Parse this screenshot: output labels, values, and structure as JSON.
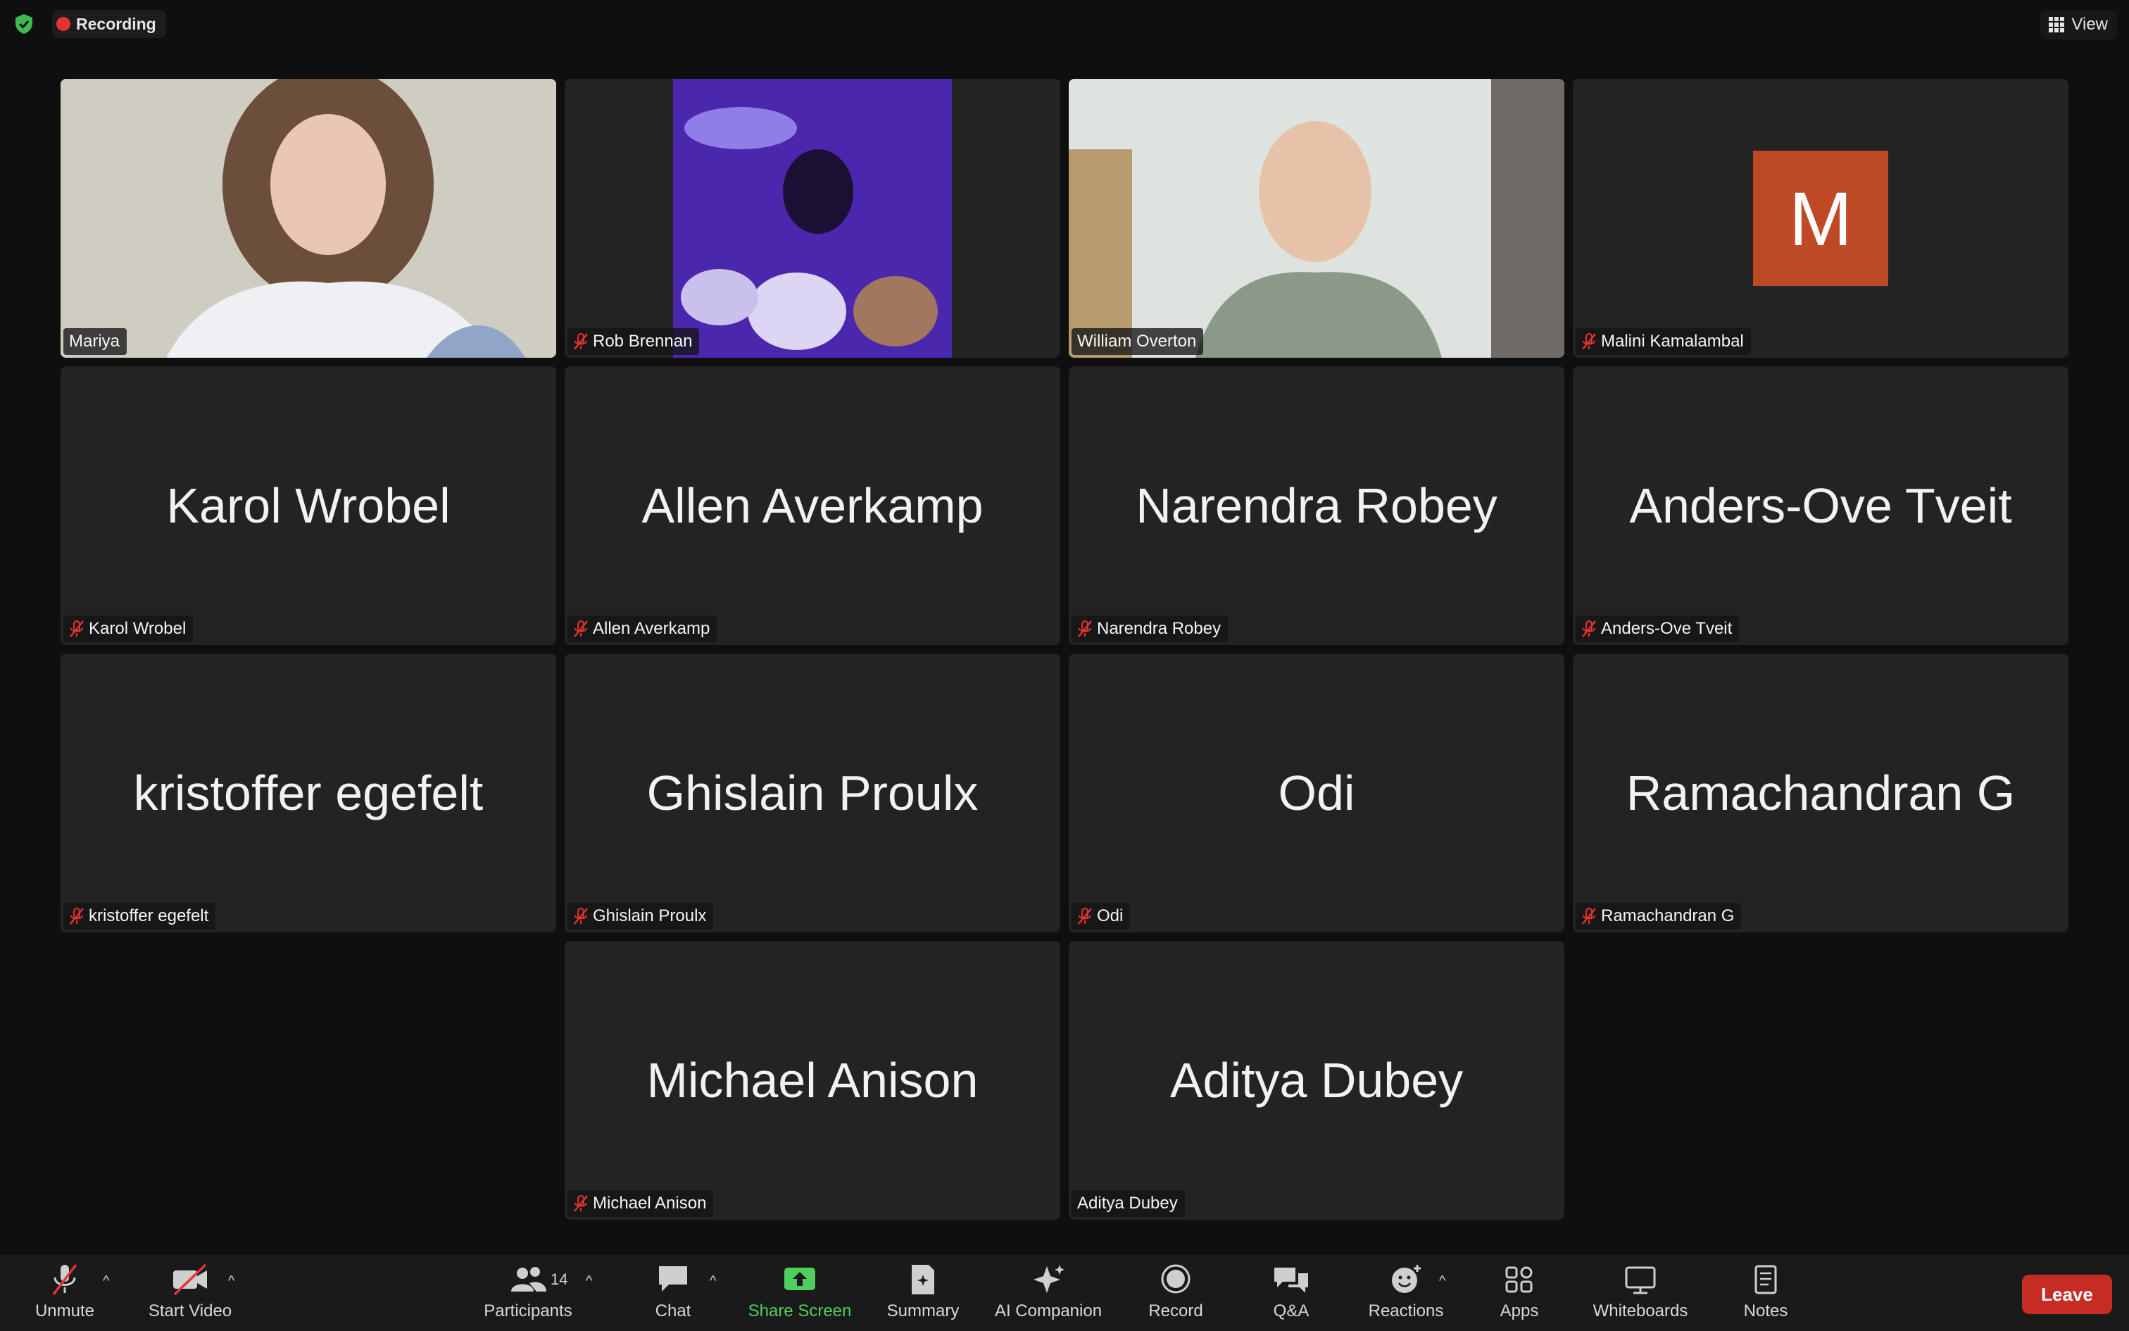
{
  "topbar": {
    "recording_label": "Recording",
    "view_label": "View"
  },
  "tiles": [
    {
      "name": "Mariya",
      "muted": false,
      "video": true,
      "active": true
    },
    {
      "name": "Rob Brennan",
      "muted": true,
      "video": true
    },
    {
      "name": "William Overton",
      "muted": false,
      "video": true
    },
    {
      "name": "Malini Kamalambal",
      "muted": true,
      "avatar": "M"
    },
    {
      "name": "Karol Wrobel",
      "muted": true,
      "display_name": "Karol Wrobel"
    },
    {
      "name": "Allen Averkamp",
      "muted": true,
      "display_name": "Allen Averkamp"
    },
    {
      "name": "Narendra Robey",
      "muted": true,
      "display_name": "Narendra Robey"
    },
    {
      "name": "Anders-Ove Tveit",
      "muted": true,
      "display_name": "Anders-Ove Tveit"
    },
    {
      "name": "kristoffer egefelt",
      "muted": true,
      "display_name": "kristoffer egefelt"
    },
    {
      "name": "Ghislain Proulx",
      "muted": true,
      "display_name": "Ghislain Proulx"
    },
    {
      "name": "Odi",
      "muted": true,
      "display_name": "Odi"
    },
    {
      "name": "Ramachandran G",
      "muted": true,
      "display_name": "Ramachandran G"
    },
    {
      "name": "Michael Anison",
      "muted": true,
      "display_name": "Michael Anison"
    },
    {
      "name": "Aditya Dubey",
      "muted": false,
      "display_name": "Aditya Dubey"
    }
  ],
  "toolbar": {
    "unmute": "Unmute",
    "start_video": "Start Video",
    "participants": "Participants",
    "participants_count": "14",
    "chat": "Chat",
    "share_screen": "Share Screen",
    "summary": "Summary",
    "ai_companion": "AI Companion",
    "record": "Record",
    "qa": "Q&A",
    "reactions": "Reactions",
    "apps": "Apps",
    "whiteboards": "Whiteboards",
    "notes": "Notes",
    "leave": "Leave"
  },
  "colors": {
    "active_speaker_border": "#4fce5d",
    "recording_dot": "#e5342f",
    "leave_button": "#c62b24",
    "avatar_bg": "#bd4a24",
    "share_screen_green": "#4fce5d"
  }
}
